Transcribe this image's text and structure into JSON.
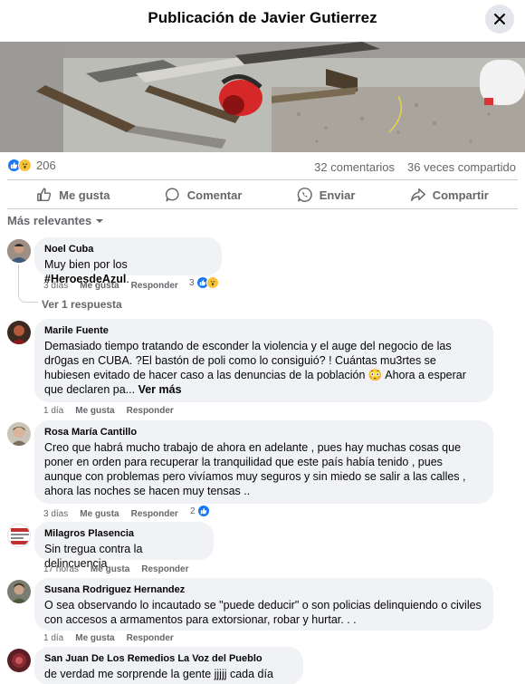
{
  "header": {
    "title": "Publicación de Javier Gutierrez"
  },
  "icons": {
    "close": "close-icon",
    "like": "like-icon",
    "comment": "comment-icon",
    "send": "whatsapp-icon",
    "share": "share-icon",
    "sort": "chevron-down-icon"
  },
  "colors": {
    "accent": "#1877f2",
    "wow": "#f7c33c",
    "secondary_text": "#65676b",
    "bubble": "#f0f2f5"
  },
  "stats": {
    "reaction_count": "206",
    "comments": "32 comentarios",
    "shares": "36 veces compartido"
  },
  "actions": {
    "like": "Me gusta",
    "comment": "Comentar",
    "send": "Enviar",
    "share": "Compartir"
  },
  "sort_label": "Más relevantes",
  "comments": [
    {
      "author": "Noel Cuba",
      "text_prefix": "Muy bien por los ",
      "hashtag": "#HeroesdeAzul",
      "text_suffix": ".",
      "time": "3 días",
      "like": "Me gusta",
      "reply": "Responder",
      "reaction_count": "3",
      "replies_link": "Ver 1 respuesta"
    },
    {
      "author": "Marile Fuente",
      "text": "Demasiado tiempo tratando de esconder la violencia y el auge del negocio de las dr0gas en CUBA. ?El bastón de poli como lo consiguió? ! Cuántas mu3rtes se hubiesen evitado de hacer caso a las denuncias de la población 😳 Ahora a esperar que declaren pa...",
      "see_more": "Ver más",
      "time": "1 día",
      "like": "Me gusta",
      "reply": "Responder"
    },
    {
      "author": "Rosa María Cantillo",
      "text": "Creo que habrá mucho trabajo de ahora en adelante , pues hay muchas cosas que poner en orden para recuperar la tranquilidad que este país había tenido , pues aunque con problemas pero vivíamos muy seguros y sin miedo se salir a las calles , ahora las noches se hacen muy tensas ..",
      "time": "3 días",
      "like": "Me gusta",
      "reply": "Responder",
      "reaction_count": "2"
    },
    {
      "author": "Milagros Plasencia",
      "text": "Sin tregua contra la delincuencia",
      "time": "17 horas",
      "like": "Me gusta",
      "reply": "Responder"
    },
    {
      "author": "Susana Rodriguez Hernandez",
      "text": "O sea observando lo incautado se \"puede deducir\" o son policias delinquiendo o civiles con accesos a armamentos para extorsionar, robar y hurtar. . .",
      "time": "1 día",
      "like": "Me gusta",
      "reply": "Responder"
    },
    {
      "author": "San Juan De Los Remedios La Voz del Pueblo",
      "text": "de verdad me sorprende la gente jjjjj cada día mas"
    }
  ]
}
